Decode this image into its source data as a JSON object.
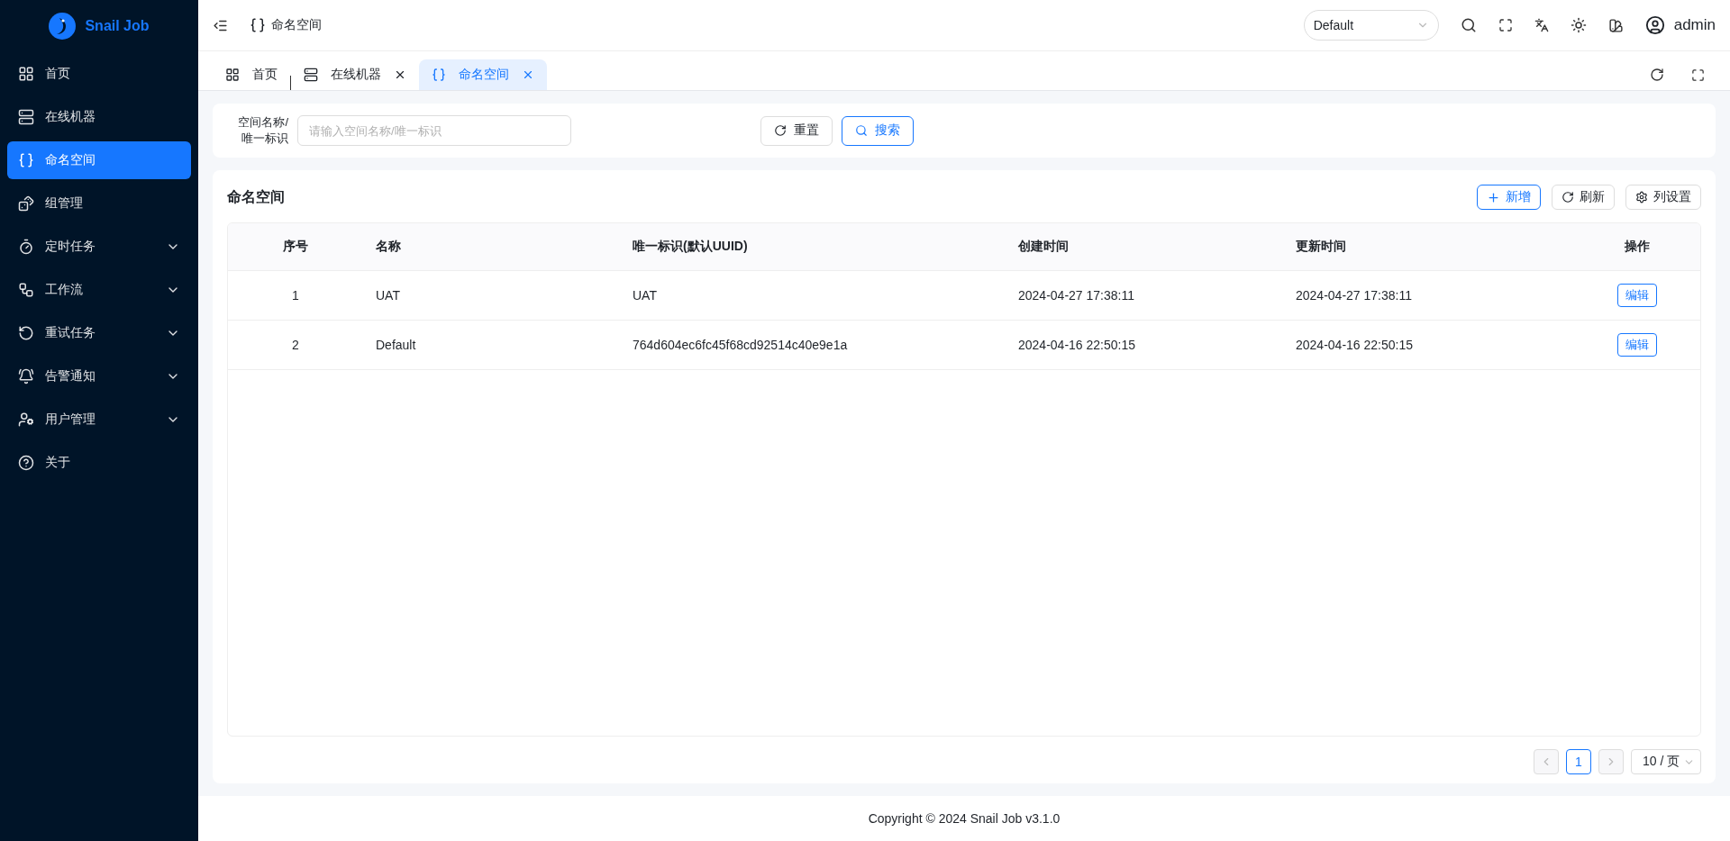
{
  "brand": "Snail Job",
  "sidebar": {
    "items": [
      {
        "label": "首页",
        "selected": false,
        "expandable": false
      },
      {
        "label": "在线机器",
        "selected": false,
        "expandable": false
      },
      {
        "label": "命名空间",
        "selected": true,
        "expandable": false
      },
      {
        "label": "组管理",
        "selected": false,
        "expandable": false
      },
      {
        "label": "定时任务",
        "selected": false,
        "expandable": true
      },
      {
        "label": "工作流",
        "selected": false,
        "expandable": true
      },
      {
        "label": "重试任务",
        "selected": false,
        "expandable": true
      },
      {
        "label": "告警通知",
        "selected": false,
        "expandable": true
      },
      {
        "label": "用户管理",
        "selected": false,
        "expandable": true
      },
      {
        "label": "关于",
        "selected": false,
        "expandable": false
      }
    ]
  },
  "header": {
    "breadcrumb": "命名空间",
    "namespace": "Default",
    "user": "admin"
  },
  "tabs": [
    {
      "label": "首页",
      "selected": false,
      "closable": false
    },
    {
      "label": "在线机器",
      "selected": false,
      "closable": true
    },
    {
      "label": "命名空间",
      "selected": true,
      "closable": true
    }
  ],
  "search": {
    "label": "空间名称/唯一标识",
    "placeholder": "请输入空间名称/唯一标识",
    "reset": "重置",
    "submit": "搜索"
  },
  "table_card": {
    "title": "命名空间",
    "add": "新增",
    "refresh": "刷新",
    "columns_setting": "列设置"
  },
  "table": {
    "columns": [
      "序号",
      "名称",
      "唯一标识(默认UUID)",
      "创建时间",
      "更新时间",
      "操作"
    ],
    "rows": [
      {
        "cells": [
          "1",
          "UAT",
          "UAT",
          "2024-04-27 17:38:11",
          "2024-04-27 17:38:11"
        ],
        "action": "编辑"
      },
      {
        "cells": [
          "2",
          "Default",
          "764d604ec6fc45f68cd92514c40e9e1a",
          "2024-04-16 22:50:15",
          "2024-04-16 22:50:15"
        ],
        "action": "编辑"
      }
    ]
  },
  "pagination": {
    "pages": [
      {
        "label": "1",
        "selected": true
      }
    ],
    "page_size": "10 / 页"
  },
  "footer": "Copyright © 2024 Snail Job v3.1.0"
}
